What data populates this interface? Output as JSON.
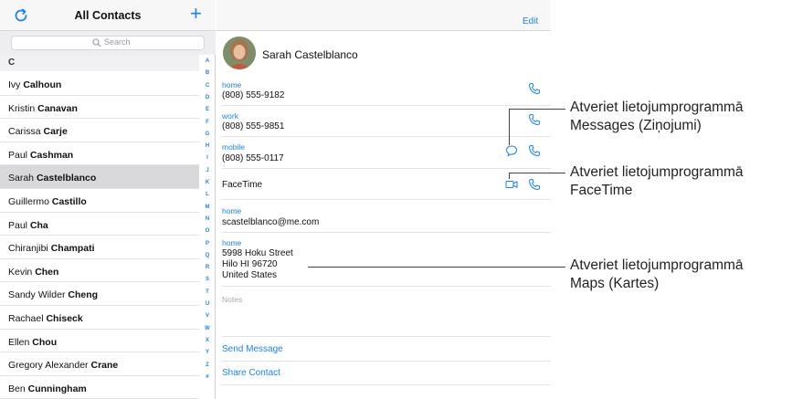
{
  "left": {
    "title": "All Contacts",
    "search_placeholder": "Search",
    "section_header": "C",
    "contacts": [
      {
        "first": "Ivy",
        "last": "Calhoun",
        "selected": false
      },
      {
        "first": "Kristin",
        "last": "Canavan",
        "selected": false
      },
      {
        "first": "Carissa",
        "last": "Carje",
        "selected": false
      },
      {
        "first": "Paul",
        "last": "Cashman",
        "selected": false
      },
      {
        "first": "Sarah",
        "last": "Castelblanco",
        "selected": true
      },
      {
        "first": "Guillermo",
        "last": "Castillo",
        "selected": false
      },
      {
        "first": "Paul",
        "last": "Cha",
        "selected": false
      },
      {
        "first": "Chiranjibi",
        "last": "Champati",
        "selected": false
      },
      {
        "first": "Kevin",
        "last": "Chen",
        "selected": false
      },
      {
        "first": "Sandy Wilder",
        "last": "Cheng",
        "selected": false
      },
      {
        "first": "Rachael",
        "last": "Chiseck",
        "selected": false
      },
      {
        "first": "Ellen",
        "last": "Chou",
        "selected": false
      },
      {
        "first": "Gregory Alexander",
        "last": "Crane",
        "selected": false
      },
      {
        "first": "Ben",
        "last": "Cunningham",
        "selected": false
      }
    ],
    "index_letters": [
      "A",
      "B",
      "C",
      "D",
      "E",
      "F",
      "G",
      "H",
      "I",
      "J",
      "K",
      "L",
      "M",
      "N",
      "O",
      "P",
      "Q",
      "R",
      "S",
      "T",
      "U",
      "V",
      "W",
      "X",
      "Y",
      "Z",
      "#"
    ]
  },
  "detail": {
    "edit_label": "Edit",
    "name": "Sarah  Castelblanco",
    "phones": [
      {
        "label": "home",
        "number": "(808) 555-9182"
      },
      {
        "label": "work",
        "number": "(808) 555-9851"
      },
      {
        "label": "mobile",
        "number": "(808) 555-0117"
      }
    ],
    "facetime_label": "FaceTime",
    "email": {
      "label": "home",
      "value": "scastelblanco@me.com"
    },
    "address": {
      "label": "home",
      "line1": "5998 Hoku Street",
      "line2": "Hilo HI 96720",
      "line3": "United States"
    },
    "notes_label": "Notes",
    "send_message": "Send Message",
    "share_contact": "Share Contact"
  },
  "callouts": {
    "messages": {
      "line1": "Atveriet lietojumprogrammā",
      "line2": "Messages (Ziņojumi)"
    },
    "facetime": {
      "line1": "Atveriet lietojumprogrammā",
      "line2": "FaceTime"
    },
    "maps": {
      "line1": "Atveriet lietojumprogrammā",
      "line2": "Maps (Kartes)"
    }
  },
  "colors": {
    "accent": "#1a82fb",
    "selected_row": "#d9d9dc"
  },
  "icons": [
    "refresh-icon",
    "add-icon",
    "search-icon",
    "phone-icon",
    "message-icon",
    "video-icon"
  ]
}
